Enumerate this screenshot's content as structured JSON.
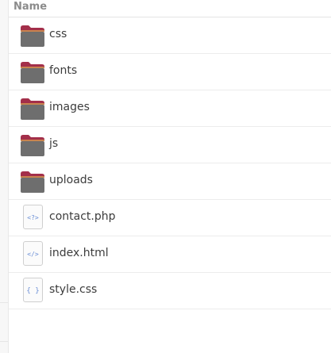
{
  "header": {
    "name_label": "Name"
  },
  "items": [
    {
      "label": "css",
      "kind": "folder",
      "icon": "folder-icon"
    },
    {
      "label": "fonts",
      "kind": "folder",
      "icon": "folder-icon"
    },
    {
      "label": "images",
      "kind": "folder",
      "icon": "folder-icon"
    },
    {
      "label": "js",
      "kind": "folder",
      "icon": "folder-icon"
    },
    {
      "label": "uploads",
      "kind": "folder",
      "icon": "folder-icon"
    },
    {
      "label": "contact.php",
      "kind": "file",
      "icon": "php-file-icon",
      "glyph": "<?>"
    },
    {
      "label": "index.html",
      "kind": "file",
      "icon": "html-file-icon",
      "glyph": "</>"
    },
    {
      "label": "style.css",
      "kind": "file",
      "icon": "css-file-icon",
      "glyph": "{ }"
    }
  ],
  "colors": {
    "folder_body": "#6e6e6e",
    "folder_tab": "#a32f4a",
    "file_glyph": "#6b8fd6"
  }
}
